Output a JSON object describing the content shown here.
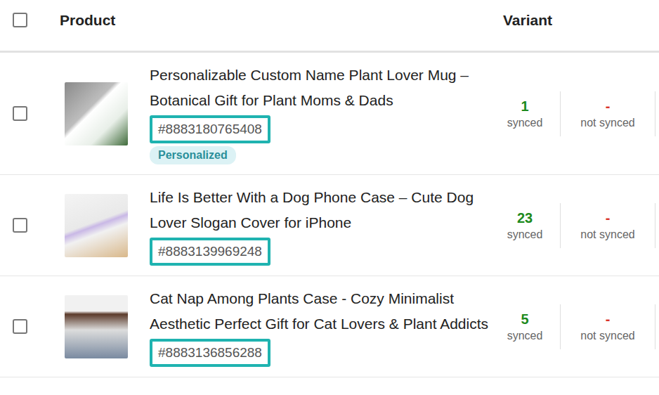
{
  "header": {
    "checked": false,
    "columns": [
      "Product",
      "Variant"
    ]
  },
  "rows": [
    {
      "checked": false,
      "title": "Personalizable Custom Name Plant Lover Mug – Botanical Gift for Plant Moms & Dads",
      "id": "#8883180765408",
      "id_highlighted": true,
      "badge": "Personalized",
      "synced": {
        "count": "1",
        "label": "synced"
      },
      "not_synced": {
        "count": "-",
        "label": "not synced"
      }
    },
    {
      "checked": false,
      "title": "Life Is Better With a Dog Phone Case – Cute Dog Lover Slogan Cover for iPhone",
      "id": "#8883139969248",
      "id_highlighted": true,
      "badge": "",
      "synced": {
        "count": "23",
        "label": "synced"
      },
      "not_synced": {
        "count": "-",
        "label": "not synced"
      }
    },
    {
      "checked": false,
      "title": "Cat Nap Among Plants Case - Cozy Minimalist Aesthetic Perfect Gift for Cat Lovers & Plant Addicts",
      "id": "#8883136856288",
      "id_highlighted": true,
      "badge": "",
      "synced": {
        "count": "5",
        "label": "synced"
      },
      "not_synced": {
        "count": "-",
        "label": "not synced"
      }
    }
  ]
}
